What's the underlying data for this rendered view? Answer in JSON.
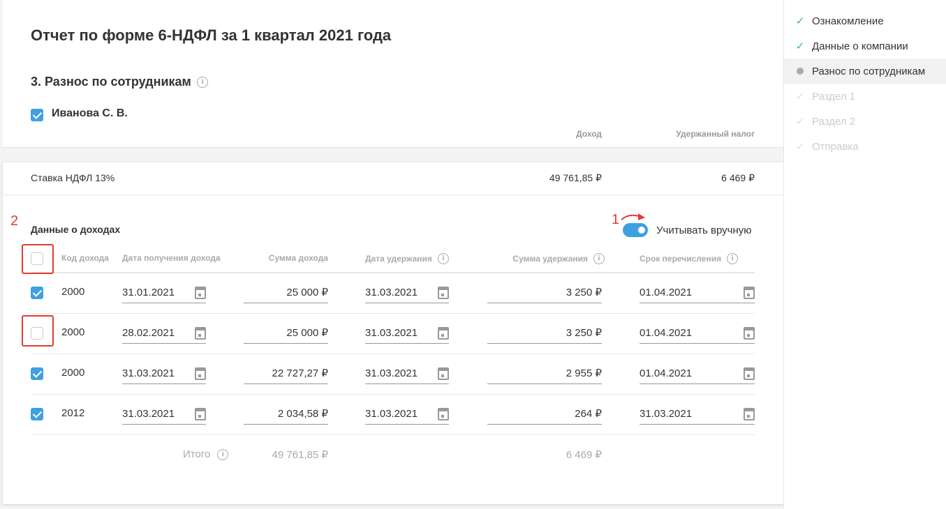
{
  "title": "Отчет по форме 6-НДФЛ за 1 квартал 2021 года",
  "section": "3. Разнос по сотрудникам",
  "employee": {
    "name": "Иванова С. В.",
    "checked": true
  },
  "summary_headers": {
    "income": "Доход",
    "tax": "Удержанный налог"
  },
  "rate": {
    "label": "Ставка НДФЛ 13%",
    "income": "49 761,85 ₽",
    "tax": "6 469 ₽"
  },
  "income_data": {
    "title": "Данные о доходах",
    "manual_toggle": {
      "label": "Учитывать вручную",
      "on": true
    },
    "columns": [
      "Код дохода",
      "Дата получения дохода",
      "Сумма дохода",
      "Дата удержания",
      "Сумма удержания",
      "Срок перечисления"
    ],
    "rows": [
      {
        "checked": true,
        "code": "2000",
        "date": "31.01.2021",
        "sum": "25 000 ₽",
        "hold_date": "31.03.2021",
        "hold_sum": "3 250 ₽",
        "due": "01.04.2021"
      },
      {
        "checked": false,
        "code": "2000",
        "date": "28.02.2021",
        "sum": "25 000 ₽",
        "hold_date": "31.03.2021",
        "hold_sum": "3 250 ₽",
        "due": "01.04.2021"
      },
      {
        "checked": true,
        "code": "2000",
        "date": "31.03.2021",
        "sum": "22 727,27 ₽",
        "hold_date": "31.03.2021",
        "hold_sum": "2 955 ₽",
        "due": "01.04.2021"
      },
      {
        "checked": true,
        "code": "2012",
        "date": "31.03.2021",
        "sum": "2 034,58 ₽",
        "hold_date": "31.03.2021",
        "hold_sum": "264 ₽",
        "due": "31.03.2021"
      }
    ],
    "total": {
      "label": "Итого",
      "income": "49 761,85 ₽",
      "tax": "6 469 ₽"
    }
  },
  "annotations": {
    "one": "1",
    "two": "2"
  },
  "steps": [
    {
      "label": "Ознакомление",
      "state": "done"
    },
    {
      "label": "Данные о компании",
      "state": "done"
    },
    {
      "label": "Разнос по сотрудникам",
      "state": "current"
    },
    {
      "label": "Раздел 1",
      "state": "todo"
    },
    {
      "label": "Раздел 2",
      "state": "todo"
    },
    {
      "label": "Отправка",
      "state": "todo"
    }
  ],
  "colors": {
    "accent": "#3ea0e0",
    "annotation": "#e03c31",
    "done": "#3cb878"
  }
}
